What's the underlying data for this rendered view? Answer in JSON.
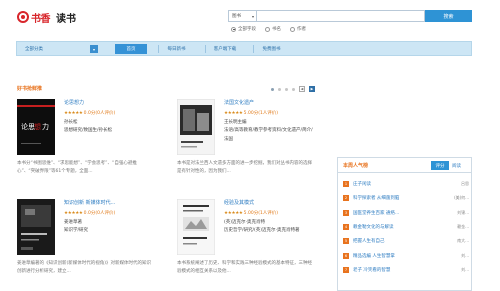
{
  "logo": {
    "brand": "书香",
    "section": "读书"
  },
  "search": {
    "field_selected": "图书",
    "input_value": "",
    "button_label": "搜索",
    "scopes": [
      {
        "label": "全部字段",
        "selected": true
      },
      {
        "label": "书名",
        "selected": false
      },
      {
        "label": "作者",
        "selected": false
      }
    ]
  },
  "nav": {
    "category_label": "全部分类",
    "tabs": [
      "首页",
      "每日新书",
      "客户端下载",
      "免费图书"
    ],
    "active_tab": 0
  },
  "section": {
    "title": "好书抢鲜推"
  },
  "books": [
    {
      "title": "论思想力",
      "stars": "★★★★★",
      "rating_text": "0.0分(0人评价)",
      "author": "孙长松",
      "category": "思想研究/致国生/孙长松",
      "description": "本书分“书图思维”、“求思能想”、“学会思考”、“自强心避推心”、“突破界限”等61个专题，全面..."
    },
    {
      "title": "法国文化遗产",
      "stars": "★★★★★",
      "rating_text": "5.00分(1人评价)",
      "author": "王长明主编",
      "category": "法语/高等教育/教学参考资料/文化遗产/简介/法国",
      "description": "本书是对法兰西人文遗多方面的进一步挖掘，我们对丛书内容的选择是有针对性的，因为我们..."
    },
    {
      "title": "知识创新 新媒体时代...",
      "stars": "★★★★★",
      "rating_text": "0.0分(0人评价)",
      "author": "姜进草著",
      "category": "知识学/研究",
      "description": "姜进草编著的《知识创新(新媒体时代的视角)》对新媒体时代的知识创新进行分析研究，建立..."
    },
    {
      "title": "经验及其模式",
      "stars": "★★★★★",
      "rating_text": "5.00分(1人评价)",
      "author": "(英)迈克尔·奥克肖特",
      "category": "历史哲学/研究/(英)迈克尔·奥克肖特著",
      "description": "本书系统阐述了历史、科学和实践三种经验模式的基本特征，三种经验模式的相互关系以及他..."
    }
  ],
  "panel": {
    "title": "本周人气榜",
    "tabs": [
      "评分",
      "阅读"
    ],
    "items": [
      {
        "rank": "1",
        "title": "庄子闲读",
        "meta": "吕思"
      },
      {
        "rank": "2",
        "title": "科学探索者 从细菌到脑",
        "meta": "(美)何..."
      },
      {
        "rank": "3",
        "title": "国医堂养生百家 通络...",
        "meta": "刘锦..."
      },
      {
        "rank": "4",
        "title": "赖金勒文化的与解读",
        "meta": "赖金..."
      },
      {
        "rank": "5",
        "title": "把握人生有自己",
        "meta": "南大..."
      },
      {
        "rank": "6",
        "title": "精品选编 人生智慧掌",
        "meta": "刘..."
      },
      {
        "rank": "7",
        "title": "老子 冷笑看的智慧",
        "meta": "刘..."
      }
    ]
  },
  "colors": {
    "accent": "#2e93d5",
    "brand_red": "#d8262b",
    "orange": "#e8731e"
  }
}
